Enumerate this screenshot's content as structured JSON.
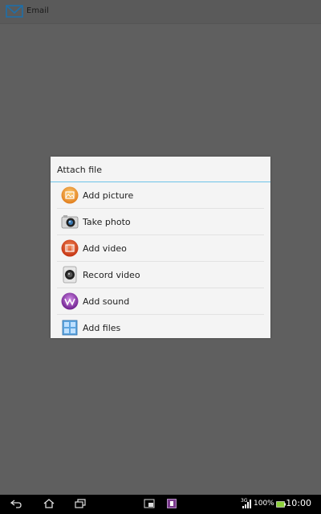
{
  "app_bar": {
    "title": "Email",
    "icon": "envelope-icon"
  },
  "dialog": {
    "title": "Attach file",
    "accent_color": "#6cc3e8",
    "items": [
      {
        "label": "Add picture",
        "icon": "picture-icon"
      },
      {
        "label": "Take photo",
        "icon": "camera-icon"
      },
      {
        "label": "Add video",
        "icon": "video-icon"
      },
      {
        "label": "Record video",
        "icon": "record-video-icon"
      },
      {
        "label": "Add sound",
        "icon": "sound-icon"
      },
      {
        "label": "Add files",
        "icon": "files-icon"
      }
    ]
  },
  "nav_bar": {
    "back_icon": "back-icon",
    "home_icon": "home-icon",
    "recents_icon": "recent-apps-icon",
    "small_app_icon": "small-app-icon",
    "widget_icon": "widget-icon",
    "network": "3G",
    "battery": "100%",
    "time": "10:00"
  }
}
